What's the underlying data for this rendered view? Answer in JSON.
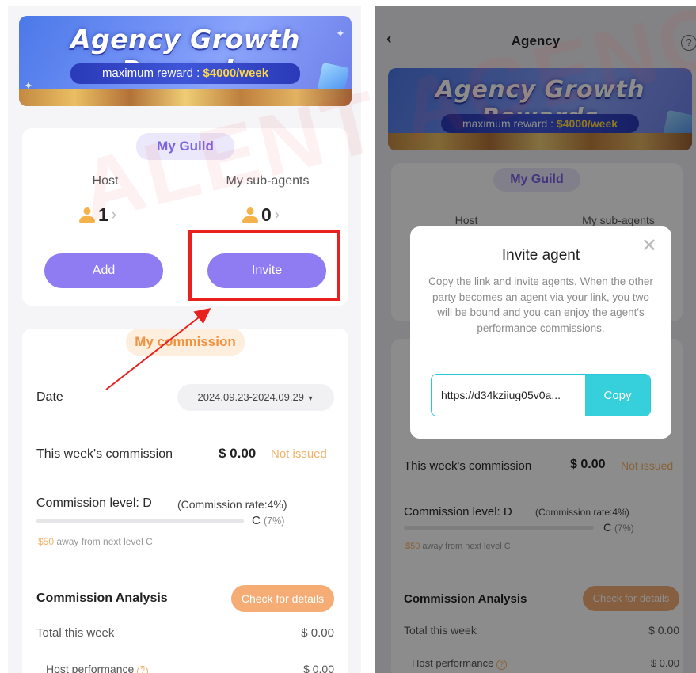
{
  "banner": {
    "title": "Agency Growth Rewards",
    "subtitle_prefix": "maximum reward : ",
    "subtitle_amount": "$4000/week"
  },
  "guild": {
    "title": "My Guild",
    "host_label": "Host",
    "host_count": "1",
    "subagents_label": "My sub-agents",
    "subagents_count": "0",
    "add_label": "Add",
    "invite_label": "Invite"
  },
  "commission": {
    "title": "My commission",
    "date_label": "Date",
    "date_range": "2024.09.23-2024.09.29",
    "week_label": "This week's commission",
    "week_amount": "$ 0.00",
    "week_status": "Not issued",
    "level_label": "Commission level: D",
    "rate_note": "(Commission rate:4%)",
    "progress": 0.0,
    "next_level": "C",
    "next_rate": "(7%)",
    "away_amount": "$50",
    "away_text": "away from next level C",
    "analysis_title": "Commission Analysis",
    "details_label": "Check for details",
    "total_label": "Total this week",
    "total_amount": "$ 0.00",
    "host_perf_label": "Host performance",
    "host_perf_amount": "$ 0.00"
  },
  "header": {
    "title": "Agency"
  },
  "invite_modal": {
    "title": "Invite agent",
    "description": "Copy the link and invite agents. When the other party becomes an agent via your link, you two will be bound and you can enjoy the agent's performance commissions.",
    "link": "https://d34kziiug05v0a...",
    "copy_label": "Copy"
  },
  "watermark": "ALENT AGENCY",
  "icons": {
    "back": "chevron-left-icon",
    "help": "question-circle-icon",
    "close": "close-icon",
    "host": "person-icon",
    "chevron": "chevron-right-icon",
    "dropdown": "caret-down-icon"
  },
  "colors": {
    "purple": "#8f7cf2",
    "orange": "#f5ad75",
    "teal": "#36d0dc",
    "highlight": "#e8201e"
  }
}
